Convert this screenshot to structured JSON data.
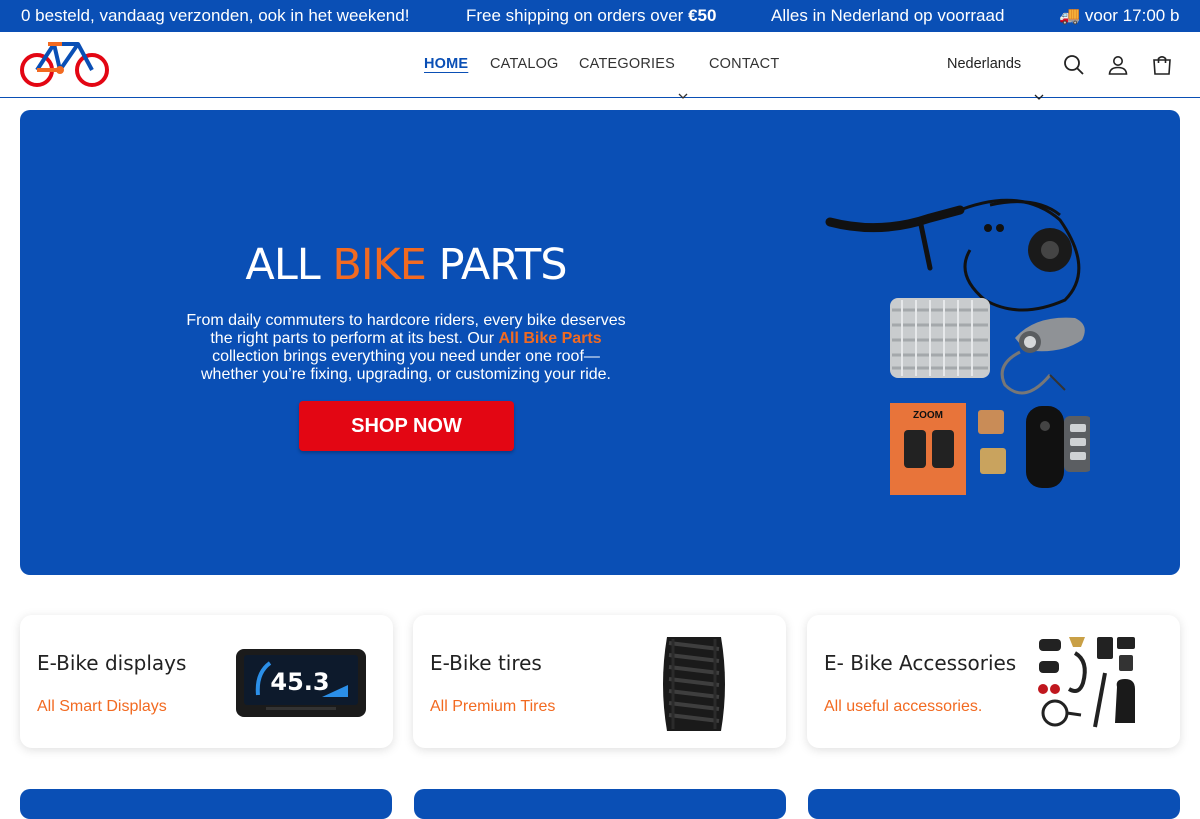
{
  "announcement": {
    "items": [
      "0 besteld, vandaag verzonden, ook in het weekend!",
      "Free shipping on orders over €50",
      "Alles in Nederland op voorraad",
      "🚚 voor 17:00 b"
    ]
  },
  "header": {
    "nav": [
      {
        "label": "HOME"
      },
      {
        "label": "CATALOG"
      },
      {
        "label": "CATEGORIES"
      },
      {
        "label": "CONTACT"
      }
    ],
    "language": "Nederlands"
  },
  "hero": {
    "title_part1": "ALL ",
    "title_accent": "BIKE",
    "title_part2": " PARTS",
    "text_part1": "From daily commuters to hardcore riders, every bike deserves the right parts to perform at its best. Our ",
    "text_accent": "All Bike Parts",
    "text_part2": " collection brings everything you need under one roof—whether you’re fixing, upgrading, or customizing your ride.",
    "button": "SHOP NOW",
    "display_value": "45.3",
    "pad_brand": "ZOOM"
  },
  "cards": [
    {
      "title": "E-Bike displays",
      "link": "All Smart Displays"
    },
    {
      "title": "E-Bike tires",
      "link": "All Premium Tires"
    },
    {
      "title": "E- Bike Accessories",
      "link": "All useful accessories."
    }
  ],
  "colors": {
    "brand_blue": "#0a4fb5",
    "accent_orange": "#f26a21",
    "button_red": "#e30613"
  }
}
